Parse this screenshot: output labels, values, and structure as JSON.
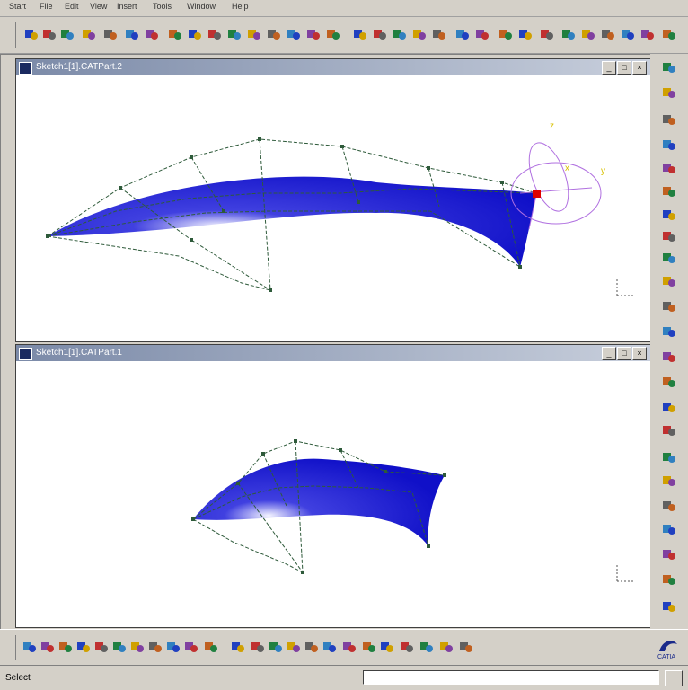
{
  "menubar": {
    "items": [
      "Start",
      "File",
      "Edit",
      "View",
      "Insert",
      "Tools",
      "Window",
      "Help"
    ]
  },
  "windows": [
    {
      "title": "Sketch1[1].CATPart.2"
    },
    {
      "title": "Sketch1[1].CATPart.1"
    }
  ],
  "window_buttons": {
    "minimize": "_",
    "maximize": "□",
    "close": "×"
  },
  "compass_labels": {
    "x": "x",
    "y": "y",
    "z": "z"
  },
  "status": {
    "text": "Select",
    "command_placeholder": ""
  },
  "brand": {
    "logo_text": "CATIA"
  },
  "colors": {
    "surface": "#1a1ad0",
    "control_net": "#2e5a3a",
    "titlebar": "#7b8aa8",
    "compass": "#b070e0",
    "select_handle": "#e00000"
  }
}
